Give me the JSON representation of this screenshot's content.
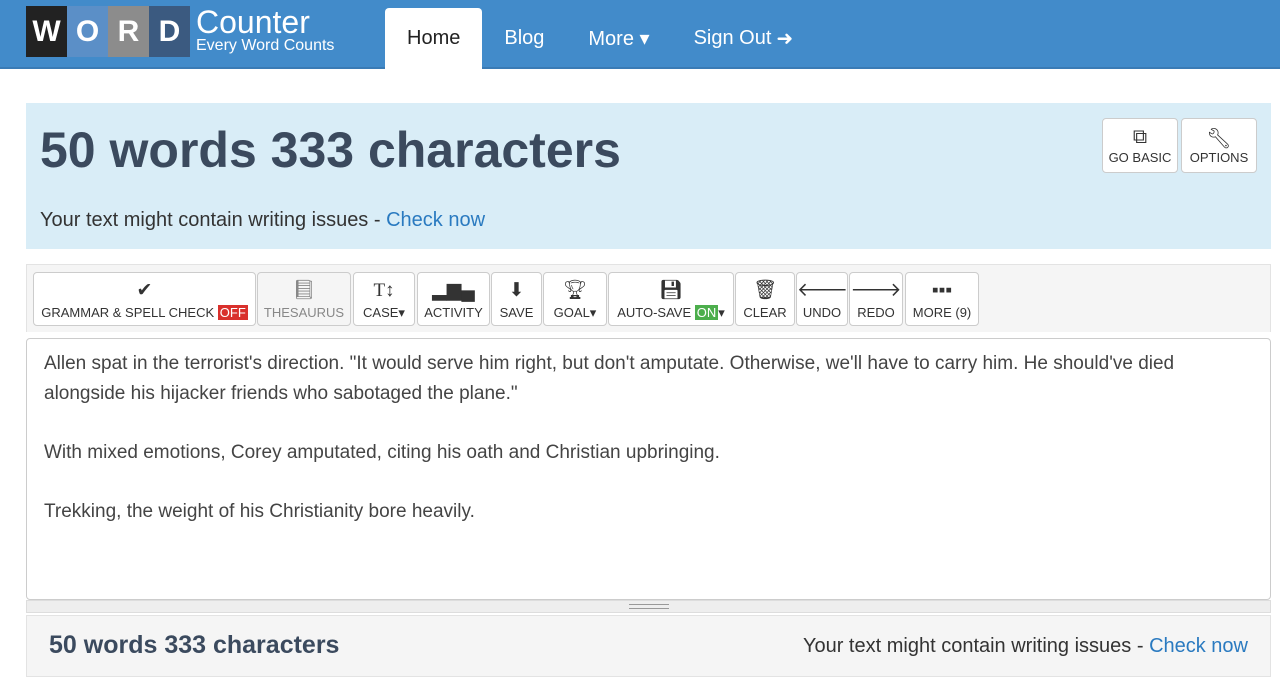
{
  "logo": {
    "letters": [
      "W",
      "O",
      "R",
      "D"
    ],
    "colors": [
      "#222222",
      "#5b8fc7",
      "#8c8c8c",
      "#3b5a80"
    ],
    "name": "Counter",
    "tagline": "Every Word Counts"
  },
  "nav": {
    "items": [
      {
        "label": "Home",
        "active": true
      },
      {
        "label": "Blog"
      },
      {
        "label": "More ▾"
      },
      {
        "label": "Sign Out"
      }
    ]
  },
  "hero": {
    "title": "50 words 333 characters",
    "issues_text": "Your text might contain writing issues - ",
    "check_link": "Check now",
    "go_basic": "GO BASIC",
    "options": "OPTIONS"
  },
  "toolbar": {
    "grammar": "GRAMMAR & SPELL CHECK",
    "grammar_state": "OFF",
    "thesaurus": "THESAURUS",
    "case": "CASE▾",
    "activity": "ACTIVITY",
    "save": "SAVE",
    "goal": "GOAL▾",
    "autosave": "AUTO-SAVE",
    "autosave_state": "ON",
    "autosave_caret": "▾",
    "clear": "CLEAR",
    "undo": "UNDO",
    "redo": "REDO",
    "more": "MORE (9)"
  },
  "editor": {
    "paragraphs": [
      "Allen spat in the terrorist's direction.  \"It would serve him right, but don't amputate.  Otherwise, we'll have to carry him. He should've died alongside his hijacker friends who sabotaged the plane.\"",
      "With mixed emotions, Corey amputated, citing his oath and Christian upbringing.",
      "Trekking, the weight of his Christianity bore heavily."
    ]
  },
  "footer": {
    "title": "50 words 333 characters",
    "issues_text": "Your text might contain writing issues - ",
    "check_link": "Check now"
  }
}
